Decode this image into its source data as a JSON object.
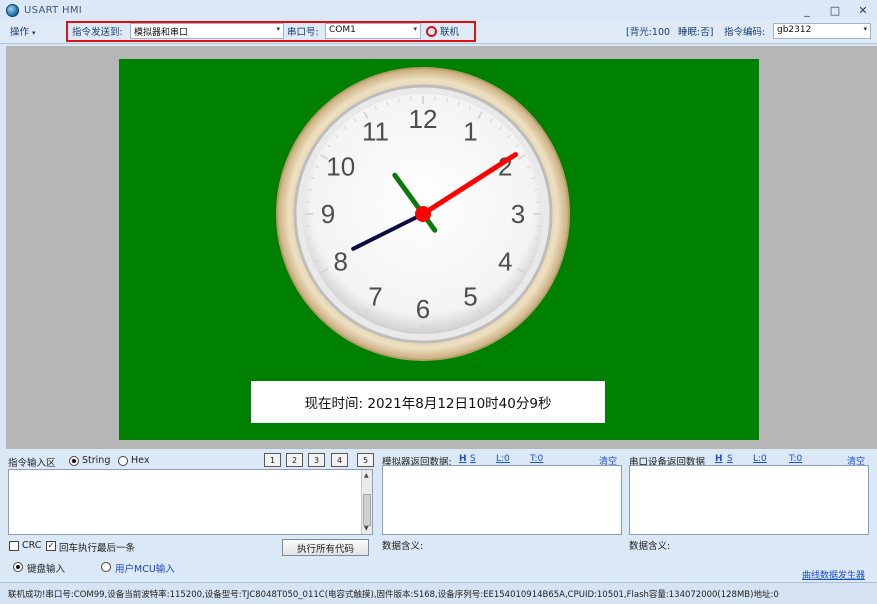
{
  "window": {
    "title": "USART HMI",
    "minimize": "_",
    "maximize": "□",
    "close": "✕"
  },
  "toolbar": {
    "ops_menu": "操作",
    "send_to_label": "指令发送到:",
    "send_to_value": "模拟器和串口",
    "port_label": "串口号:",
    "port_value": "COM1",
    "connect_label": "联机",
    "backlight": "[背光:100",
    "sleep": "睡眠:否]",
    "encoding_label": "指令编码:",
    "encoding_value": "gb2312"
  },
  "clock": {
    "numbers": [
      "12",
      "1",
      "2",
      "3",
      "4",
      "5",
      "6",
      "7",
      "8",
      "9",
      "10",
      "11"
    ],
    "hour": 10,
    "minute": 40,
    "second": 9,
    "hand_colors": {
      "hour": "#0a7a0a",
      "minute": "#0a0a40",
      "second": "#ff0000"
    },
    "time_text": "现在时间:  2021年8月12日10时40分9秒"
  },
  "colors": {
    "screen_bg": "#008000",
    "red_box": "#e01010",
    "link": "#1a4fd6"
  },
  "input_area": {
    "title": "指令输入区",
    "radio_string": "String",
    "radio_hex": "Hex",
    "num_buttons": [
      "1",
      "2",
      "3",
      "4",
      "5"
    ],
    "crc_label": "CRC",
    "enter_exec_label": "回车执行最后一条",
    "exec_all_button": "执行所有代码",
    "keyboard_input": "键盘输入",
    "user_mcu_input": "用户MCU输入"
  },
  "sim_return": {
    "title": "模拟器返回数据:",
    "h": "H",
    "s": "S",
    "l0": "L:0",
    "t0": "T:0",
    "clear": "清空",
    "meaning": "数据含义:"
  },
  "serial_return": {
    "title": "串口设备返回数据",
    "h": "H",
    "s": "S",
    "l0": "L:0",
    "t0": "T:0",
    "clear": "清空",
    "meaning": "数据含义:"
  },
  "curve_generator": "曲线数据发生器",
  "status": {
    "text": "联机成功!串口号:COM99,设备当前波特率:115200,设备型号:TJC8048T050_011C(电容式触摸),固件版本:S168,设备序列号:EE154010914B65A,CPUID:10501,Flash容量:134072000(128MB)地址:0"
  }
}
